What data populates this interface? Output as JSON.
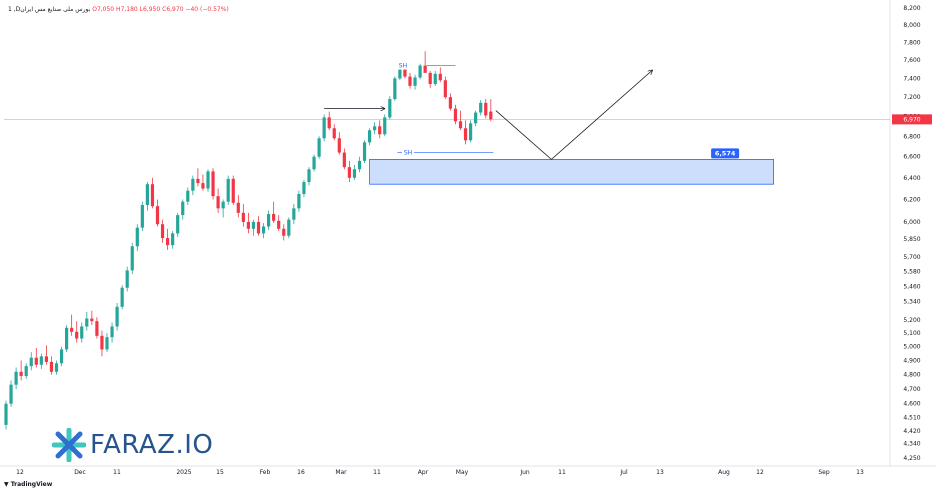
{
  "header": {
    "symbol": "1 ,Dبورس ملی صنایع مس ایران",
    "open_label": "O",
    "open": "7,050",
    "high_label": "H",
    "high": "7,180",
    "low_label": "L",
    "low": "6,950",
    "close_label": "C",
    "close": "6,970",
    "change": "−40 (−0.57%)"
  },
  "branding": {
    "logo_text": "FARAZ.IO",
    "tv": "TradingView"
  },
  "colors": {
    "up": "#26a69a",
    "down": "#f23645",
    "zone_fill": "#bbd3fa",
    "zone_border": "#2962ff",
    "label_bg": "#2962ff"
  },
  "chart_data": {
    "type": "candlestick",
    "current_price": 6970,
    "current_price_label": "6,970",
    "y_ticks": [
      4250,
      4340,
      4420,
      4510,
      4600,
      4700,
      4800,
      4900,
      5000,
      5100,
      5200,
      5340,
      5460,
      5580,
      5700,
      5850,
      6000,
      6200,
      6400,
      6600,
      6800,
      7000,
      7200,
      7400,
      7600,
      7800,
      8000,
      8200
    ],
    "y_tick_labels": [
      "4,250",
      "4,340",
      "4,420",
      "4,510",
      "4,600",
      "4,700",
      "4,800",
      "4,900",
      "5,000",
      "5,100",
      "5,200",
      "5,340",
      "5,460",
      "5,580",
      "5,700",
      "5,850",
      "6,000",
      "6,200",
      "6,400",
      "6,600",
      "6,800",
      "7,000",
      "7,200",
      "7,400",
      "7,600",
      "7,800",
      "8,000",
      "8,200"
    ],
    "x_tick_labels": [
      "12",
      "Dec",
      "11",
      "2025",
      "15",
      "Feb",
      "16",
      "Mar",
      "11",
      "Apr",
      "May",
      "Jun",
      "11",
      "Jul",
      "13",
      "Aug",
      "12",
      "Sep",
      "13"
    ],
    "candles": [
      [
        4460,
        4620,
        4430,
        4600
      ],
      [
        4600,
        4760,
        4580,
        4730
      ],
      [
        4730,
        4850,
        4700,
        4820
      ],
      [
        4820,
        4900,
        4760,
        4790
      ],
      [
        4790,
        4880,
        4770,
        4860
      ],
      [
        4860,
        4960,
        4830,
        4920
      ],
      [
        4920,
        4990,
        4850,
        4870
      ],
      [
        4870,
        4950,
        4840,
        4930
      ],
      [
        4930,
        5010,
        4870,
        4890
      ],
      [
        4890,
        4930,
        4800,
        4820
      ],
      [
        4820,
        4900,
        4800,
        4880
      ],
      [
        4880,
        5000,
        4860,
        4980
      ],
      [
        4980,
        5160,
        4960,
        5140
      ],
      [
        5140,
        5240,
        5080,
        5110
      ],
      [
        5110,
        5190,
        5030,
        5060
      ],
      [
        5060,
        5180,
        5030,
        5150
      ],
      [
        5150,
        5260,
        5120,
        5210
      ],
      [
        5210,
        5270,
        5160,
        5190
      ],
      [
        5190,
        5220,
        5060,
        5080
      ],
      [
        5080,
        5120,
        4930,
        4980
      ],
      [
        4980,
        5100,
        4960,
        5070
      ],
      [
        5070,
        5180,
        5030,
        5150
      ],
      [
        5150,
        5330,
        5120,
        5300
      ],
      [
        5300,
        5470,
        5280,
        5450
      ],
      [
        5450,
        5620,
        5420,
        5590
      ],
      [
        5590,
        5820,
        5560,
        5790
      ],
      [
        5790,
        5980,
        5750,
        5950
      ],
      [
        5950,
        6180,
        5920,
        6150
      ],
      [
        6150,
        6360,
        6100,
        6340
      ],
      [
        6340,
        6400,
        6120,
        6140
      ],
      [
        6140,
        6200,
        5960,
        5980
      ],
      [
        5980,
        6020,
        5820,
        5860
      ],
      [
        5860,
        5940,
        5760,
        5800
      ],
      [
        5800,
        5920,
        5770,
        5900
      ],
      [
        5900,
        6080,
        5870,
        6060
      ],
      [
        6060,
        6200,
        6020,
        6180
      ],
      [
        6180,
        6310,
        6150,
        6280
      ],
      [
        6280,
        6420,
        6240,
        6390
      ],
      [
        6390,
        6490,
        6320,
        6350
      ],
      [
        6350,
        6430,
        6280,
        6300
      ],
      [
        6300,
        6480,
        6270,
        6460
      ],
      [
        6460,
        6490,
        6200,
        6230
      ],
      [
        6230,
        6300,
        6080,
        6120
      ],
      [
        6120,
        6200,
        6040,
        6180
      ],
      [
        6180,
        6420,
        6150,
        6390
      ],
      [
        6390,
        6420,
        6150,
        6170
      ],
      [
        6170,
        6240,
        6040,
        6080
      ],
      [
        6080,
        6160,
        5960,
        6000
      ],
      [
        6000,
        6080,
        5900,
        5940
      ],
      [
        5940,
        6020,
        5880,
        6000
      ],
      [
        6000,
        6050,
        5880,
        5900
      ],
      [
        5900,
        5990,
        5860,
        5960
      ],
      [
        5960,
        6100,
        5930,
        6070
      ],
      [
        6070,
        6180,
        5990,
        6010
      ],
      [
        6010,
        6060,
        5920,
        5940
      ],
      [
        5940,
        5980,
        5840,
        5880
      ],
      [
        5880,
        6040,
        5860,
        6020
      ],
      [
        6020,
        6160,
        5980,
        6120
      ],
      [
        6120,
        6280,
        6090,
        6250
      ],
      [
        6250,
        6380,
        6220,
        6360
      ],
      [
        6360,
        6500,
        6330,
        6480
      ],
      [
        6480,
        6620,
        6460,
        6600
      ],
      [
        6600,
        6800,
        6580,
        6780
      ],
      [
        6780,
        7020,
        6750,
        6990
      ],
      [
        6990,
        7050,
        6860,
        6880
      ],
      [
        6880,
        6920,
        6760,
        6780
      ],
      [
        6780,
        6840,
        6620,
        6640
      ],
      [
        6640,
        6680,
        6480,
        6500
      ],
      [
        6500,
        6560,
        6360,
        6400
      ],
      [
        6400,
        6520,
        6380,
        6480
      ],
      [
        6480,
        6600,
        6450,
        6560
      ],
      [
        6560,
        6760,
        6540,
        6740
      ],
      [
        6740,
        6880,
        6710,
        6860
      ],
      [
        6860,
        6940,
        6820,
        6900
      ],
      [
        6900,
        6960,
        6780,
        6820
      ],
      [
        6820,
        7020,
        6800,
        6990
      ],
      [
        6990,
        7210,
        6970,
        7180
      ],
      [
        7180,
        7420,
        7160,
        7400
      ],
      [
        7400,
        7560,
        7380,
        7540
      ],
      [
        7540,
        7580,
        7400,
        7420
      ],
      [
        7420,
        7460,
        7290,
        7320
      ],
      [
        7320,
        7440,
        7280,
        7410
      ],
      [
        7410,
        7560,
        7390,
        7540
      ],
      [
        7540,
        7700,
        7500,
        7460
      ],
      [
        7460,
        7480,
        7300,
        7340
      ],
      [
        7340,
        7480,
        7320,
        7450
      ],
      [
        7450,
        7520,
        7360,
        7380
      ],
      [
        7380,
        7420,
        7180,
        7200
      ],
      [
        7200,
        7240,
        7060,
        7080
      ],
      [
        7080,
        7120,
        6920,
        6950
      ],
      [
        6950,
        7060,
        6860,
        6880
      ],
      [
        6880,
        6960,
        6720,
        6760
      ],
      [
        6760,
        6960,
        6740,
        6930
      ],
      [
        6930,
        7060,
        6900,
        7040
      ],
      [
        7040,
        7170,
        7010,
        7140
      ],
      [
        7140,
        7180,
        6980,
        7010
      ],
      [
        7050,
        7180,
        6950,
        6970
      ]
    ],
    "annotations": [
      {
        "type": "label",
        "text": "SH",
        "x": 78.6,
        "y": 7540
      },
      {
        "type": "label",
        "text": "SH",
        "x": 79.6,
        "y": 6640
      },
      {
        "type": "zone",
        "x_start": 72,
        "x_end": 152,
        "y_top": 6574,
        "y_bottom": 6340
      },
      {
        "type": "price_label",
        "text": "6,574",
        "x": 142,
        "y": 6574
      },
      {
        "type": "arrow",
        "from": [
          63,
          7080
        ],
        "to": [
          75,
          7080
        ]
      },
      {
        "type": "path",
        "points": [
          [
            97,
            7060
          ],
          [
            108,
            6574
          ],
          [
            128,
            7490
          ]
        ]
      }
    ]
  }
}
